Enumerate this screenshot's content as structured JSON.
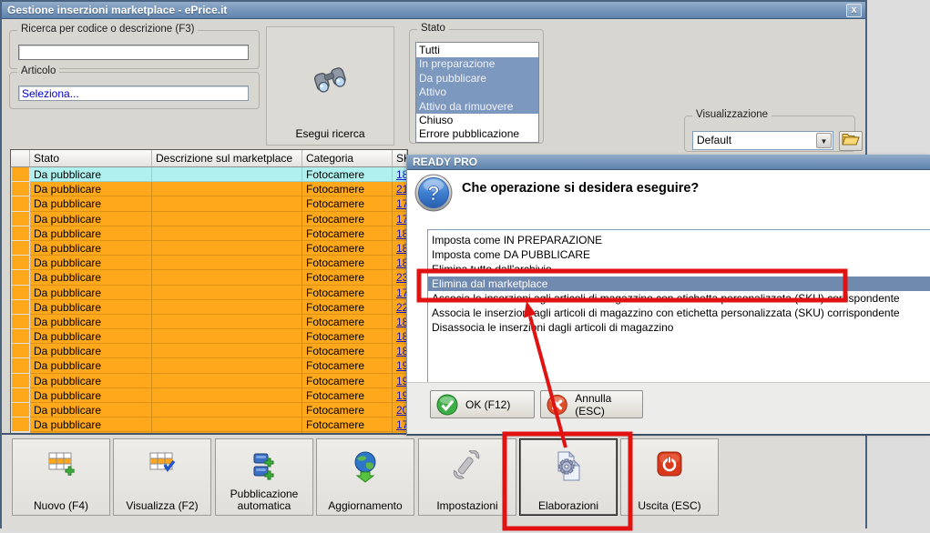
{
  "window": {
    "title": "Gestione inserzioni marketplace - ePrice.it",
    "close_icon": "close-icon"
  },
  "search": {
    "group_label": "Ricerca per codice o descrizione (F3)",
    "input_value": ""
  },
  "articolo": {
    "group_label": "Articolo",
    "link_text": "Seleziona..."
  },
  "esegui": {
    "label": "Esegui ricerca",
    "icon": "binoculars-icon"
  },
  "stato": {
    "group_label": "Stato",
    "items": [
      {
        "label": "Tutti",
        "selected": false
      },
      {
        "label": "In preparazione",
        "selected": true
      },
      {
        "label": "Da pubblicare",
        "selected": true
      },
      {
        "label": "Attivo",
        "selected": true
      },
      {
        "label": "Attivo da rimuovere",
        "selected": true
      },
      {
        "label": "Chiuso",
        "selected": false
      },
      {
        "label": "Errore pubblicazione",
        "selected": false
      }
    ]
  },
  "visualizzazione": {
    "group_label": "Visualizzazione",
    "value": "Default",
    "dropdown_icon": "chevron-down-icon",
    "folder_icon": "folder-icon"
  },
  "table": {
    "headers": [
      "Stato",
      "Descrizione sul marketplace",
      "Categoria",
      "SK"
    ],
    "rows": [
      {
        "stato": "Da pubblicare",
        "descrizione": "",
        "categoria": "Fotocamere",
        "sku": "18",
        "highlighted": true
      },
      {
        "stato": "Da pubblicare",
        "descrizione": "",
        "categoria": "Fotocamere",
        "sku": "21",
        "highlighted": false
      },
      {
        "stato": "Da pubblicare",
        "descrizione": "",
        "categoria": "Fotocamere",
        "sku": "17",
        "highlighted": false
      },
      {
        "stato": "Da pubblicare",
        "descrizione": "",
        "categoria": "Fotocamere",
        "sku": "17",
        "highlighted": false
      },
      {
        "stato": "Da pubblicare",
        "descrizione": "",
        "categoria": "Fotocamere",
        "sku": "18",
        "highlighted": false
      },
      {
        "stato": "Da pubblicare",
        "descrizione": "",
        "categoria": "Fotocamere",
        "sku": "18",
        "highlighted": false
      },
      {
        "stato": "Da pubblicare",
        "descrizione": "",
        "categoria": "Fotocamere",
        "sku": "18",
        "highlighted": false
      },
      {
        "stato": "Da pubblicare",
        "descrizione": "",
        "categoria": "Fotocamere",
        "sku": "23",
        "highlighted": false
      },
      {
        "stato": "Da pubblicare",
        "descrizione": "",
        "categoria": "Fotocamere",
        "sku": "17",
        "highlighted": false
      },
      {
        "stato": "Da pubblicare",
        "descrizione": "",
        "categoria": "Fotocamere",
        "sku": "22",
        "highlighted": false
      },
      {
        "stato": "Da pubblicare",
        "descrizione": "",
        "categoria": "Fotocamere",
        "sku": "18",
        "highlighted": false
      },
      {
        "stato": "Da pubblicare",
        "descrizione": "",
        "categoria": "Fotocamere",
        "sku": "18",
        "highlighted": false
      },
      {
        "stato": "Da pubblicare",
        "descrizione": "",
        "categoria": "Fotocamere",
        "sku": "18",
        "highlighted": false
      },
      {
        "stato": "Da pubblicare",
        "descrizione": "",
        "categoria": "Fotocamere",
        "sku": "19",
        "highlighted": false
      },
      {
        "stato": "Da pubblicare",
        "descrizione": "",
        "categoria": "Fotocamere",
        "sku": "19",
        "highlighted": false
      },
      {
        "stato": "Da pubblicare",
        "descrizione": "",
        "categoria": "Fotocamere",
        "sku": "19",
        "highlighted": false
      },
      {
        "stato": "Da pubblicare",
        "descrizione": "",
        "categoria": "Fotocamere",
        "sku": "20",
        "highlighted": false
      },
      {
        "stato": "Da pubblicare",
        "descrizione": "",
        "categoria": "Fotocamere",
        "sku": "17",
        "highlighted": false
      }
    ],
    "partial_row_visible": true
  },
  "dialog": {
    "title": "READY PRO",
    "question": "Che operazione si desidera eseguire?",
    "question_icon": "question-mark-icon",
    "operations": [
      "Imposta come IN PREPARAZIONE",
      "Imposta come DA PUBBLICARE",
      "Elimina tutto dall'archivio",
      "Elimina dal marketplace",
      "Associa le inserzioni agli articoli di magazzino con etichetta personalizzata (SKU) corrispondente",
      "Associa le inserzioni agli articoli di magazzino con etichetta personalizzata (SKU) corrispondente",
      "Disassocia le inserzioni dagli articoli di magazzino"
    ],
    "selected_index": 3,
    "ok_label": "OK (F12)",
    "ok_icon": "check-circle-icon",
    "cancel_label": "Annulla (ESC)",
    "cancel_icon": "cancel-circle-icon"
  },
  "toolbar": {
    "buttons": [
      {
        "label": "Nuovo (F4)",
        "icon": "new-grid-icon"
      },
      {
        "label": "Visualizza (F2)",
        "icon": "view-grid-icon"
      },
      {
        "label": "Pubblicazione automatica",
        "icon": "auto-publish-icon"
      },
      {
        "label": "Aggiornamento",
        "icon": "globe-refresh-icon"
      },
      {
        "label": "Impostazioni",
        "icon": "wrench-icon"
      },
      {
        "label": "Elaborazioni",
        "icon": "pages-gear-icon"
      },
      {
        "label": "Uscita (ESC)",
        "icon": "power-icon"
      }
    ]
  },
  "annotations": {
    "highlight_color": "#e01212",
    "boxed_items": [
      "Elimina dal marketplace",
      "Elaborazioni"
    ]
  },
  "colors": {
    "titlebar_blue": "#7495ba",
    "row_orange": "#ffa81c",
    "row_highlight_cyan": "#aff1ee",
    "selection_blue": "#7d98be",
    "dialog_selection_blue": "#7089ae",
    "link_blue": "#1414cc"
  }
}
